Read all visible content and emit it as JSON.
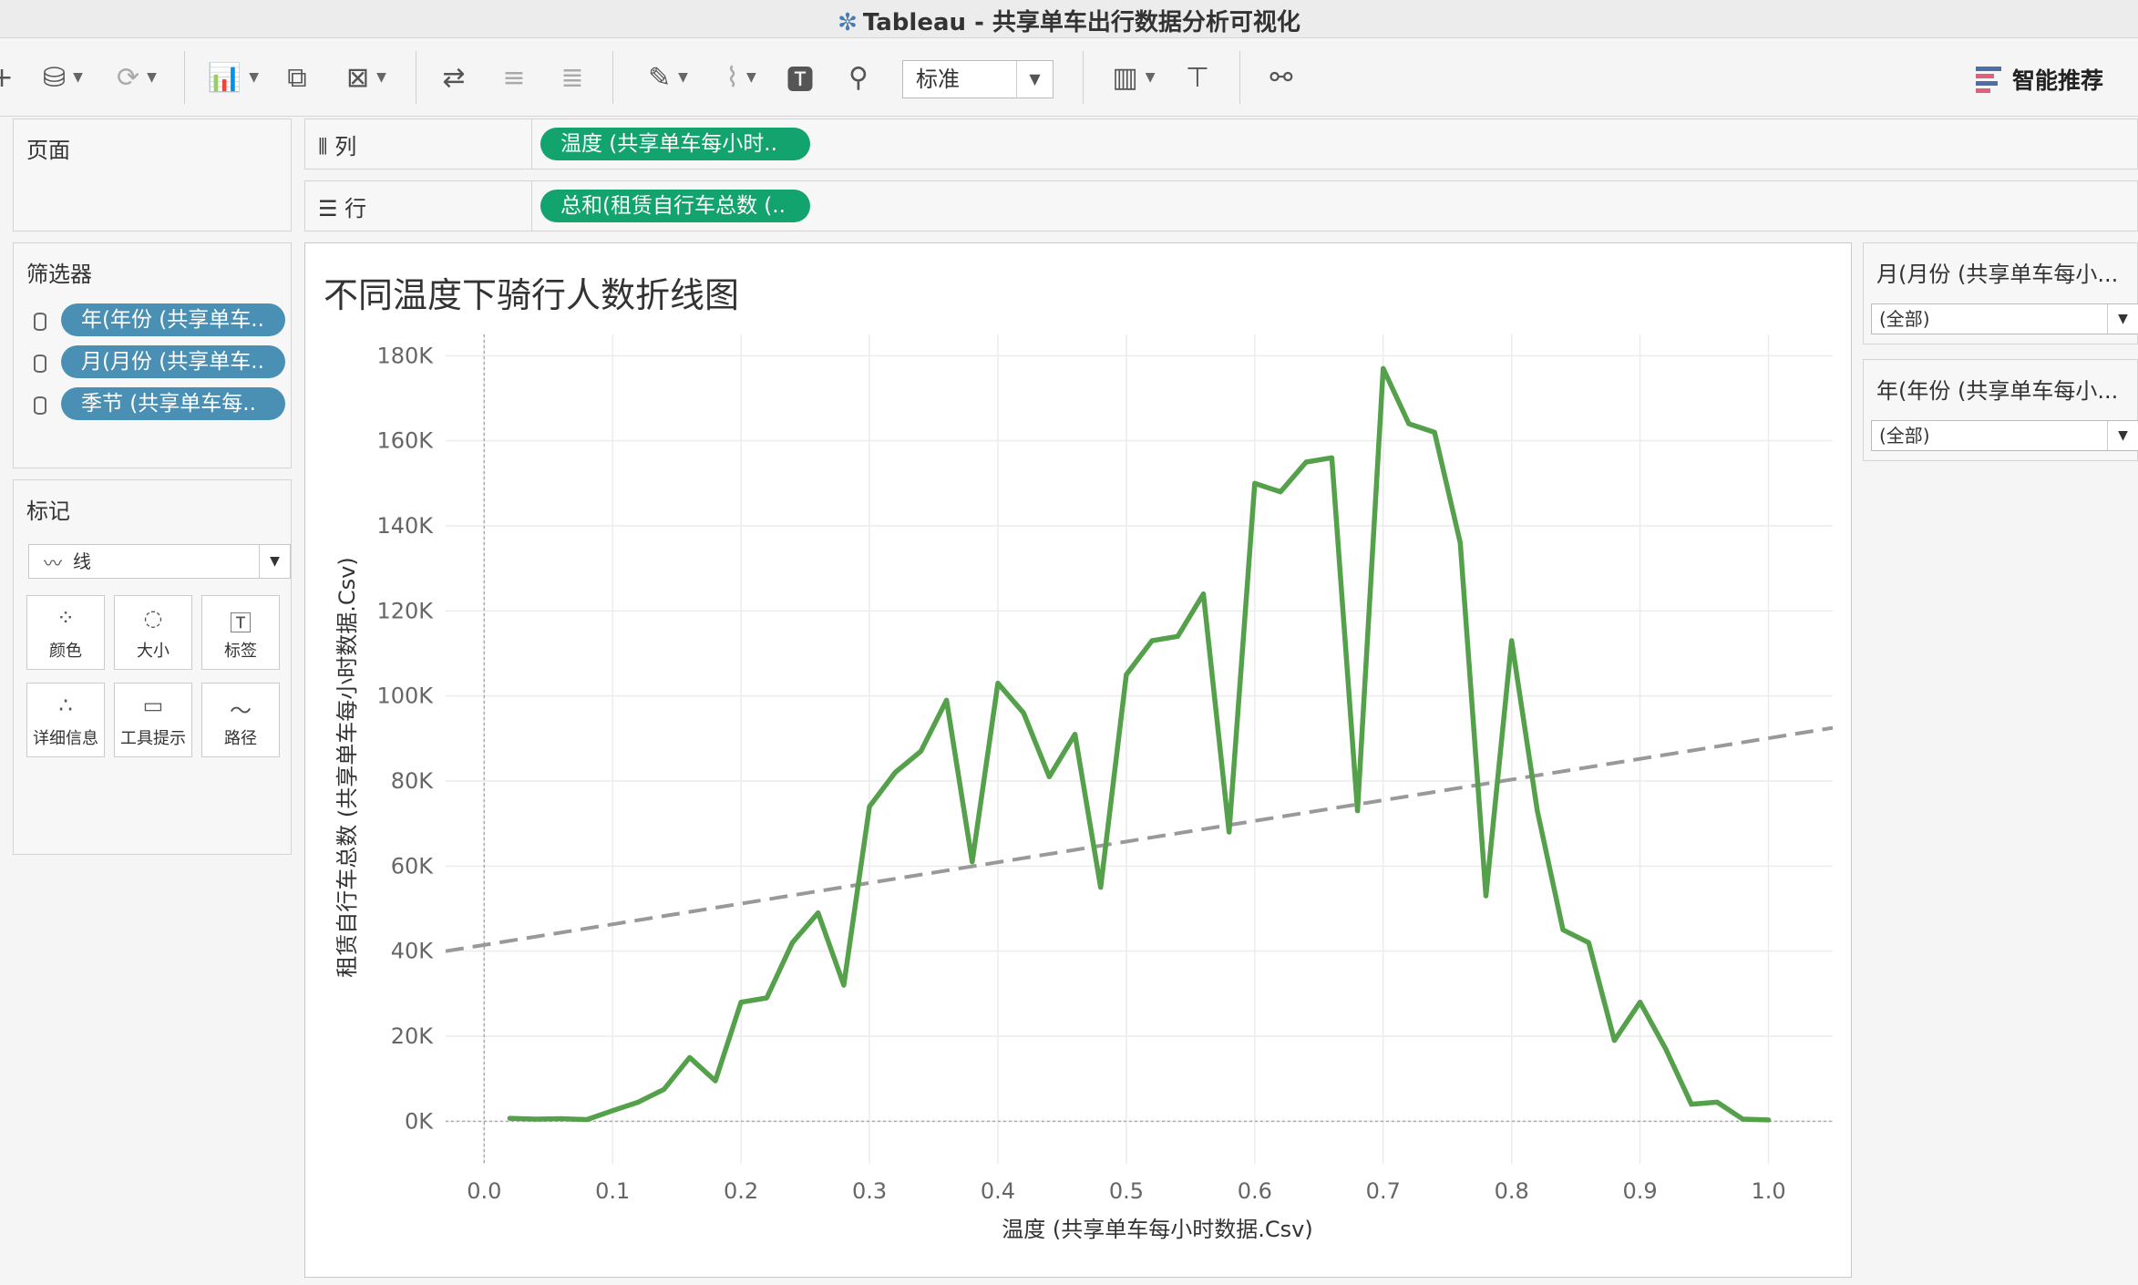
{
  "window": {
    "title": "Tableau - 共享单车出行数据分析可视化"
  },
  "toolbar": {
    "fit_value": "标准",
    "smart_label": "智能推荐"
  },
  "sidebar": {
    "pages_label": "页面",
    "filters_label": "筛选器",
    "filters": [
      {
        "label": "年(年份 (共享单车.."
      },
      {
        "label": "月(月份 (共享单车.."
      },
      {
        "label": "季节 (共享单车每.."
      }
    ],
    "marks_label": "标记",
    "marks_type": "线",
    "marks_cards": [
      {
        "label": "颜色",
        "icon": "color-icon"
      },
      {
        "label": "大小",
        "icon": "size-icon"
      },
      {
        "label": "标签",
        "icon": "label-icon"
      },
      {
        "label": "详细信息",
        "icon": "detail-icon"
      },
      {
        "label": "工具提示",
        "icon": "tooltip-icon"
      },
      {
        "label": "路径",
        "icon": "path-icon"
      }
    ]
  },
  "shelves": {
    "columns_label": "列",
    "columns_pill": "温度 (共享单车每小时..",
    "rows_label": "行",
    "rows_pill": "总和(租赁自行车总数 (.."
  },
  "right_filters": [
    {
      "title": "月(月份 (共享单车每小...",
      "value": "(全部)"
    },
    {
      "title": "年(年份 (共享单车每小...",
      "value": "(全部)"
    }
  ],
  "colors": {
    "line": "#55a04a",
    "trend": "#999999",
    "pill_blue": "#4a90b4",
    "pill_green": "#12a36e"
  },
  "chart_data": {
    "type": "line",
    "title": "不同温度下骑行人数折线图",
    "xlabel": "温度 (共享单车每小时数据.Csv)",
    "ylabel": "租赁自行车总数 (共享单车每小时数据.Csv)",
    "xlim": [
      -0.03,
      1.05
    ],
    "ylim": [
      -10000,
      185000
    ],
    "x_ticks": [
      "0.0",
      "0.1",
      "0.2",
      "0.3",
      "0.4",
      "0.5",
      "0.6",
      "0.7",
      "0.8",
      "0.9",
      "1.0"
    ],
    "x_tick_values": [
      0,
      0.1,
      0.2,
      0.3,
      0.4,
      0.5,
      0.6,
      0.7,
      0.8,
      0.9,
      1.0
    ],
    "y_ticks": [
      "0K",
      "20K",
      "40K",
      "60K",
      "80K",
      "100K",
      "120K",
      "140K",
      "160K",
      "180K"
    ],
    "y_tick_values": [
      0,
      20000,
      40000,
      60000,
      80000,
      100000,
      120000,
      140000,
      160000,
      180000
    ],
    "grid": true,
    "series": [
      {
        "x": [
          0.02,
          0.04,
          0.06,
          0.08,
          0.1,
          0.12,
          0.14,
          0.16,
          0.18,
          0.2,
          0.22,
          0.24,
          0.26,
          0.28,
          0.3,
          0.32,
          0.34,
          0.36,
          0.38,
          0.4,
          0.42,
          0.44,
          0.46,
          0.48,
          0.5,
          0.52,
          0.54,
          0.56,
          0.58,
          0.6,
          0.62,
          0.64,
          0.66,
          0.68,
          0.7,
          0.72,
          0.74,
          0.76,
          0.78,
          0.8,
          0.82,
          0.84,
          0.86,
          0.88,
          0.9,
          0.92,
          0.94,
          0.96,
          0.98,
          1.0
        ],
        "values": [
          700,
          500,
          600,
          400,
          2500,
          4500,
          7500,
          15000,
          9500,
          28000,
          29000,
          42000,
          49000,
          32000,
          74000,
          82000,
          87000,
          99000,
          61000,
          103000,
          96000,
          81000,
          91000,
          55000,
          105000,
          113000,
          114000,
          124000,
          68000,
          150000,
          148000,
          155000,
          156000,
          73000,
          177000,
          164000,
          162000,
          136000,
          53000,
          113000,
          73000,
          45000,
          42000,
          19000,
          28000,
          17000,
          4000,
          4500,
          500,
          300
        ]
      }
    ],
    "trend_line": {
      "x": [
        -0.03,
        1.05
      ],
      "values": [
        40000,
        92500
      ]
    }
  }
}
